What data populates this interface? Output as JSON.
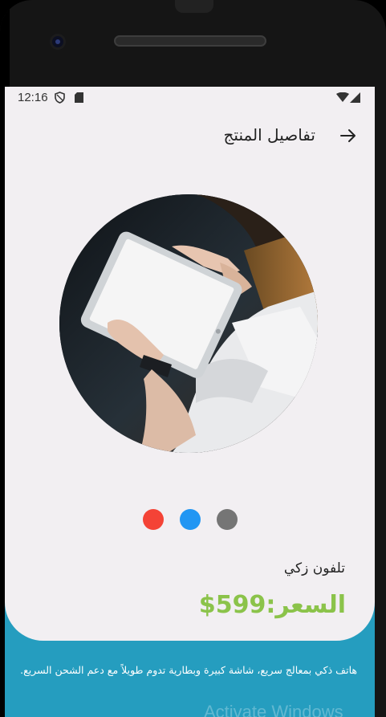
{
  "status_bar": {
    "time": "12:16",
    "icons": [
      "shield-icon",
      "sd-card-icon",
      "wifi-icon",
      "signal-icon"
    ]
  },
  "app_bar": {
    "title": "تفاصيل المنتج",
    "back_icon": "arrow-right-icon"
  },
  "product": {
    "image_description_icon": "tablet-photo",
    "color_options": [
      {
        "name": "red",
        "color": "#f44336"
      },
      {
        "name": "blue",
        "color": "#2196f3"
      },
      {
        "name": "grey",
        "color": "#757575"
      }
    ],
    "name": "تلفون زكي",
    "price": "السعر:599$",
    "description": "هاتف ذكي بمعالج سريع، شاشة كبيرة وبطارية تدوم طويلاً مع دعم الشحن السريع."
  },
  "overlay": {
    "watermark": "Activate Windows"
  },
  "colors": {
    "screen_bg": "#f2eff2",
    "accent_blue": "#259dbf",
    "price_green": "#8bc34a"
  }
}
